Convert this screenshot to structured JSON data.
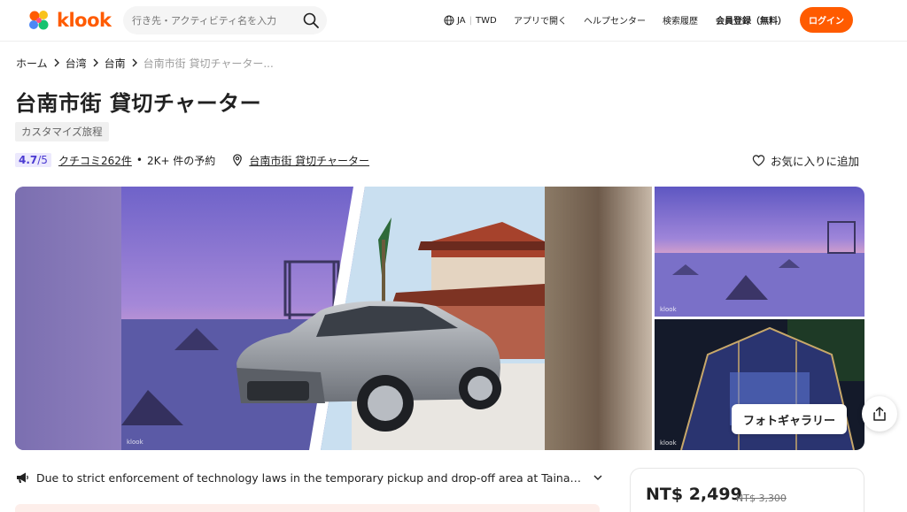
{
  "header": {
    "logo_text": "klook",
    "search_placeholder": "行き先・アクティビティ名を入力",
    "language": "JA",
    "currency": "TWD",
    "nav": [
      "アプリで開く",
      "ヘルプセンター",
      "検索履歴",
      "会員登録（無料）"
    ],
    "login_label": "ログイン",
    "brand_color": "#ff5b00"
  },
  "breadcrumb": [
    "ホーム",
    "台湾",
    "台南",
    "台南市街 貸切チャーター..."
  ],
  "activity": {
    "title": "台南市街 貸切チャーター",
    "tag": "カスタマイズ旅程",
    "rating": "4.7",
    "rating_suffix": "/5",
    "reviews": "クチコミ262件",
    "bookings": "2K+ 件の予約",
    "location": "台南市街 貸切チャーター",
    "wishlist_label": "お気に入りに追加"
  },
  "gallery": {
    "watermark": "klook",
    "button_label": "フォトギャラリー"
  },
  "notice": {
    "text": "Due to strict enforcement of technology laws in the temporary pickup and drop-off area at Tainan High Speed Rail Station, pick-up and drop-off arrangements may change."
  },
  "price_card": {
    "price": "NT$ 2,499",
    "original_price": "NT$ 3,300"
  }
}
